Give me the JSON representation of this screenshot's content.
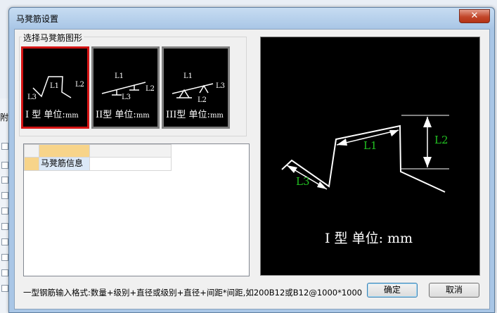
{
  "dialog": {
    "title": "马凳筋设置",
    "close_glyph": "✕"
  },
  "background": {
    "partial_text": "附加"
  },
  "shapes": {
    "legend": "选择马凳筋图形",
    "tiles": [
      {
        "type": "I 型",
        "unit": "单位:",
        "unit_value": "mm",
        "l1": "L1",
        "l2": "L2",
        "l3": "L3"
      },
      {
        "type": "II型",
        "unit": "单位:",
        "unit_value": "mm",
        "l1": "L1",
        "l2": "L2",
        "l3": "L3"
      },
      {
        "type": "III型",
        "unit": "单位:",
        "unit_value": "mm",
        "l1": "L1",
        "l2": "L2",
        "l3": "L3"
      }
    ]
  },
  "grid": {
    "row_label": "马凳筋信息",
    "row_value": ""
  },
  "preview": {
    "caption": "I 型  单位: mm",
    "l1": "L1",
    "l2": "L2",
    "l3": "L3",
    "label_color": "#22c022"
  },
  "footer": {
    "format_hint": "一型钢筋输入格式:数量+级别+直径或级别+直径+间距*间距,如200B12或B12@1000*1000",
    "ok_label": "确定",
    "cancel_label": "取消"
  }
}
